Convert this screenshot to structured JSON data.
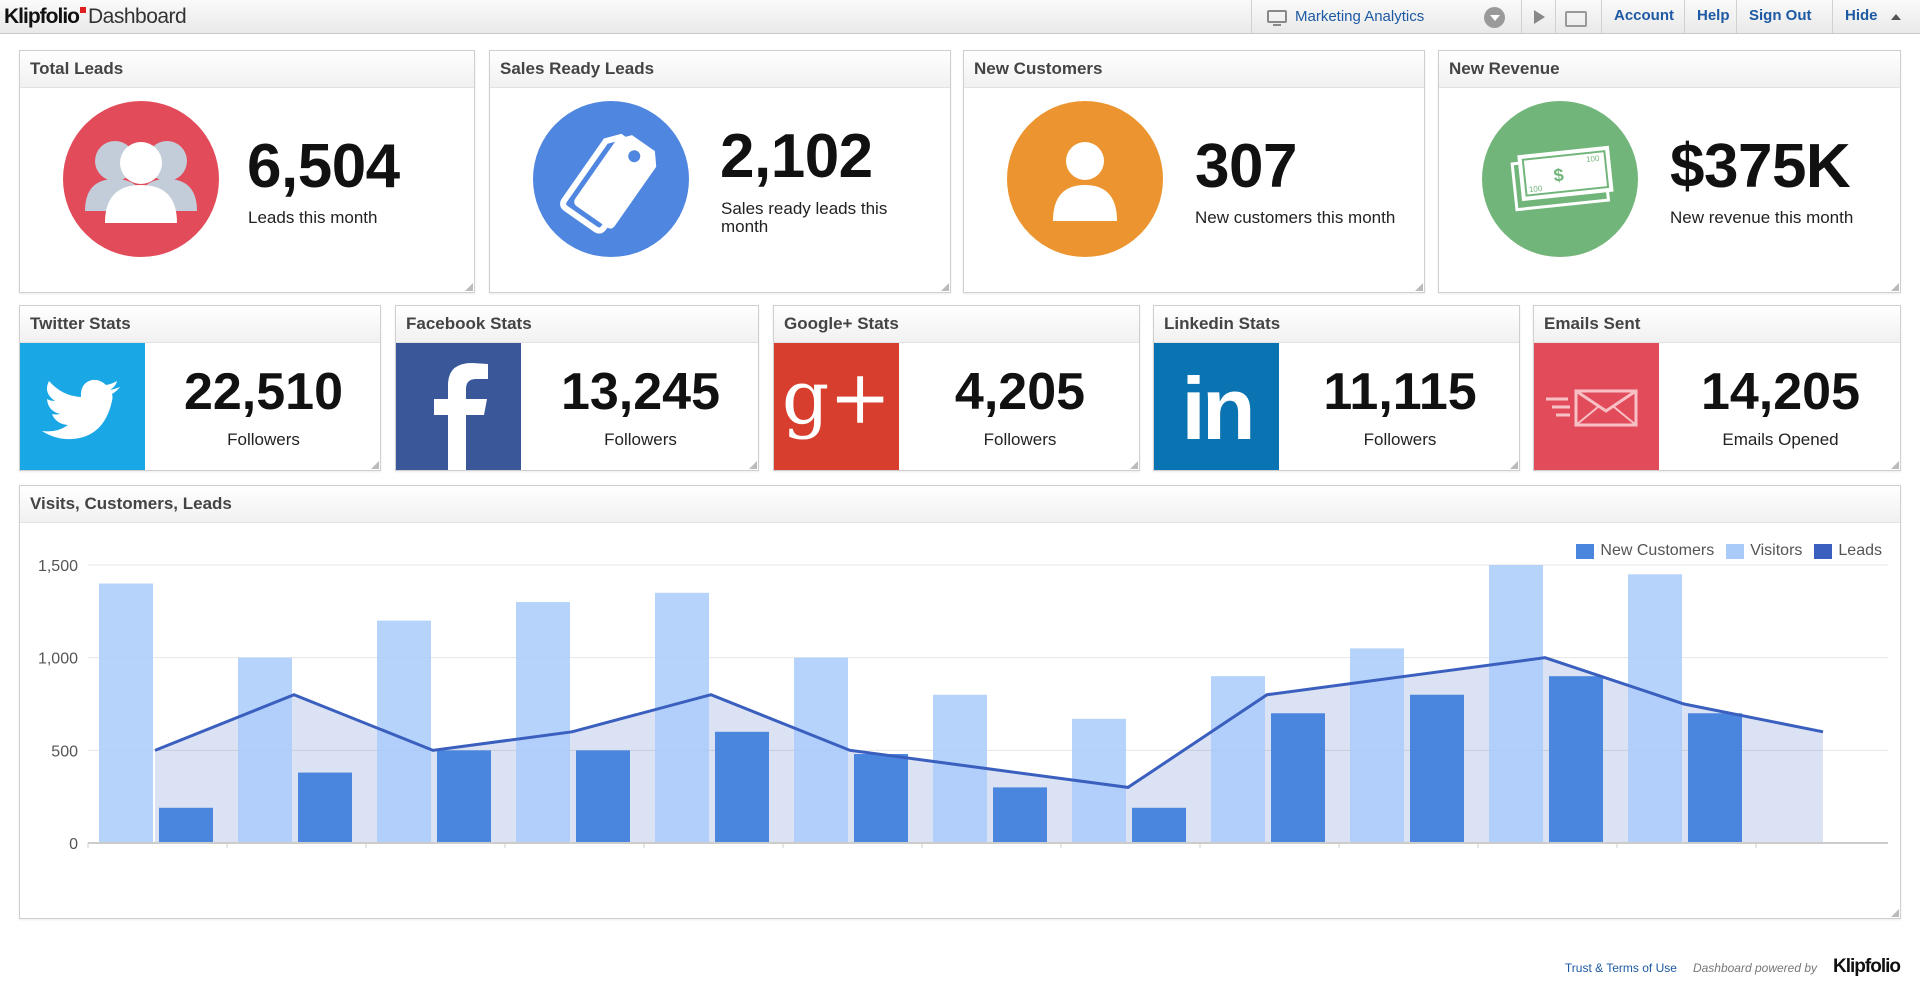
{
  "app": {
    "brand": "Klipfolio",
    "product": "Dashboard"
  },
  "topbar": {
    "dashboard_name": "Marketing Analytics",
    "links": [
      "Account",
      "Help",
      "Sign Out",
      "Hide"
    ]
  },
  "kpis": [
    {
      "title": "Total Leads",
      "value": "6,504",
      "label": "Leads this month",
      "color": "#e24c5a",
      "icon": "users-icon"
    },
    {
      "title": "Sales Ready Leads",
      "value": "2,102",
      "label": "Sales ready leads this month",
      "color": "#4f86e0",
      "icon": "tag-icon"
    },
    {
      "title": "New Customers",
      "value": "307",
      "label": "New customers this month",
      "color": "#ec9530",
      "icon": "user-icon"
    },
    {
      "title": "New Revenue",
      "value": "$375K",
      "label": "New revenue this month",
      "color": "#72b57b",
      "icon": "money-icon",
      "bill_labels": [
        "100",
        "100",
        "$"
      ]
    }
  ],
  "social": [
    {
      "title": "Twitter Stats",
      "value": "22,510",
      "label": "Followers",
      "color": "#1aa7e6",
      "icon": "twitter-icon"
    },
    {
      "title": "Facebook Stats",
      "value": "13,245",
      "label": "Followers",
      "color": "#3a579a",
      "icon": "facebook-icon"
    },
    {
      "title": "Google+ Stats",
      "value": "4,205",
      "label": "Followers",
      "color": "#d83e2d",
      "icon": "google-plus-icon",
      "glyph": "g+"
    },
    {
      "title": "Linkedin Stats",
      "value": "11,115",
      "label": "Followers",
      "color": "#0a73b1",
      "icon": "linkedin-icon",
      "glyph": "in"
    },
    {
      "title": "Emails Sent",
      "value": "14,205",
      "label": "Emails Opened",
      "color": "#e24c5a",
      "icon": "envelope-icon"
    }
  ],
  "chart_panel": {
    "title": "Visits, Customers, Leads"
  },
  "chart_data": {
    "type": "bar",
    "ylim": [
      0,
      1500
    ],
    "yticks": [
      "0",
      "500",
      "1,000",
      "1,500"
    ],
    "grid": true,
    "legend_position": "top-right",
    "series": [
      {
        "name": "New Customers",
        "type": "bar",
        "color": "#4a86de",
        "values": [
          190,
          380,
          500,
          500,
          600,
          480,
          300,
          190,
          700,
          800,
          900,
          700
        ]
      },
      {
        "name": "Visitors",
        "type": "bar",
        "color": "#a9cbfa",
        "values": [
          1400,
          1000,
          1200,
          1300,
          1350,
          1000,
          800,
          670,
          900,
          1050,
          1500,
          1450
        ]
      },
      {
        "name": "Leads",
        "type": "line",
        "color": "#3a5fbf",
        "values": [
          500,
          800,
          500,
          600,
          800,
          500,
          400,
          300,
          800,
          900,
          1000,
          750,
          600
        ]
      }
    ]
  },
  "footer": {
    "terms": "Trust & Terms of Use",
    "powered": "Dashboard powered by",
    "logo": "Klipfolio"
  }
}
